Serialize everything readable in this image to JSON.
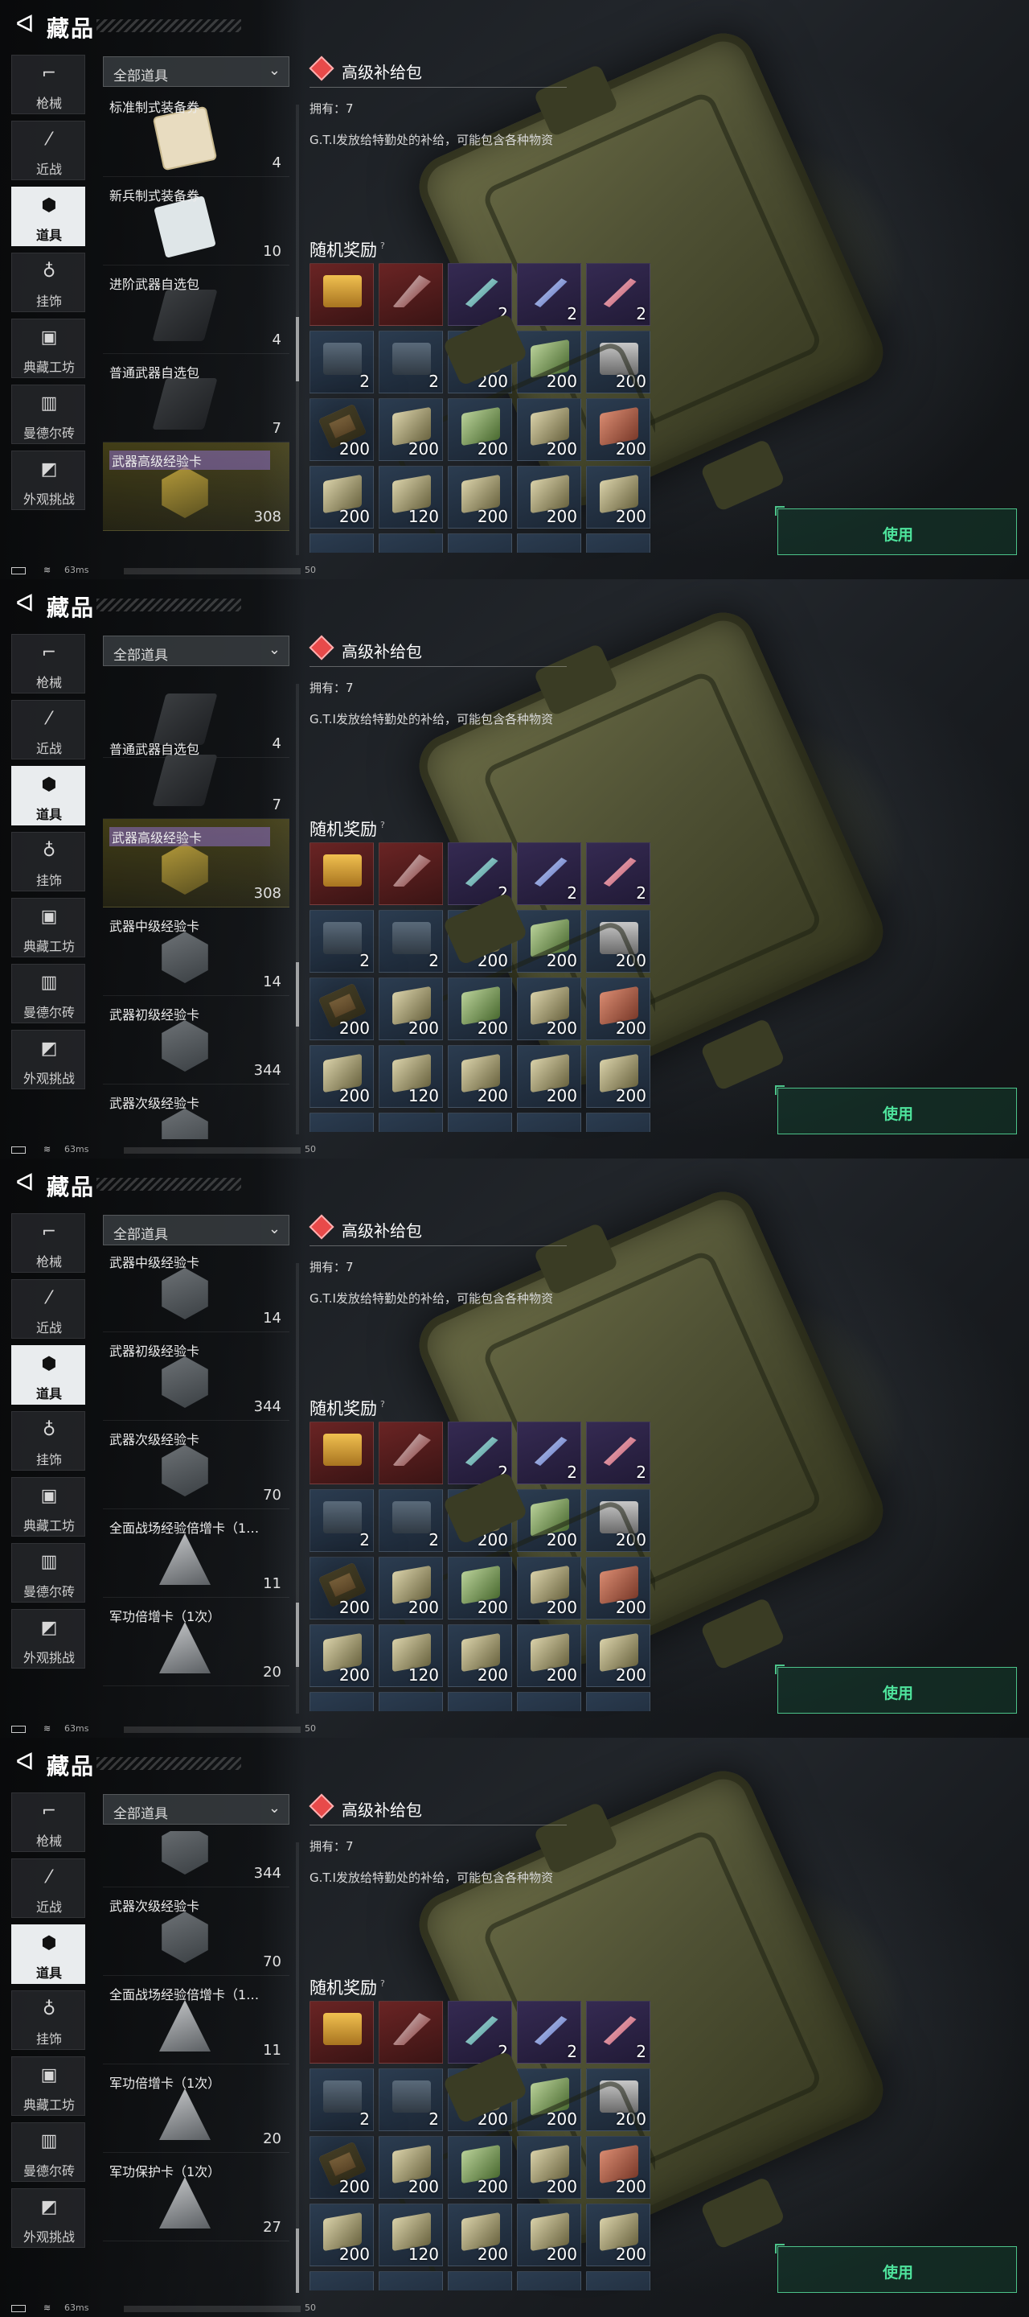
{
  "header": {
    "back_icon": "back-arrow-icon",
    "title": "藏品"
  },
  "categories": [
    {
      "label": "枪械",
      "icon": "gun-icon"
    },
    {
      "label": "近战",
      "icon": "knife-icon"
    },
    {
      "label": "道具",
      "icon": "grenades-icon",
      "active": true
    },
    {
      "label": "挂饰",
      "icon": "charm-icon"
    },
    {
      "label": "典藏工坊",
      "icon": "workshop-icon"
    },
    {
      "label": "曼德尔砖",
      "icon": "brick-icon"
    },
    {
      "label": "外观挑战",
      "icon": "challenge-icon"
    }
  ],
  "filter": {
    "value": "全部道具"
  },
  "detail": {
    "name": "高级补给包",
    "owned": "拥有：7",
    "desc": "G.T.I发放给特勤处的补给，可能包含各种物资",
    "rewards_title": "随机奖励",
    "rewards_tip": "?"
  },
  "use_label": "使用",
  "status": {
    "ping": "63ms",
    "fps": "50"
  },
  "rewards": [
    {
      "cls": "red",
      "g": "gold",
      "n": ""
    },
    {
      "cls": "red",
      "g": "knife",
      "n": ""
    },
    {
      "cls": "pur",
      "g": "syr",
      "n": "2"
    },
    {
      "cls": "pur",
      "g": "syrb",
      "n": "2"
    },
    {
      "cls": "pur",
      "g": "syrr",
      "n": "2"
    },
    {
      "cls": "",
      "g": "pack",
      "n": "2"
    },
    {
      "cls": "",
      "g": "pack",
      "n": "2"
    },
    {
      "cls": "",
      "g": "ammo",
      "n": "200"
    },
    {
      "cls": "",
      "g": "ammog",
      "n": "200"
    },
    {
      "cls": "",
      "g": "tin",
      "n": "200"
    },
    {
      "cls": "",
      "g": "crate",
      "n": "200"
    },
    {
      "cls": "",
      "g": "ammo",
      "n": "200"
    },
    {
      "cls": "",
      "g": "ammog",
      "n": "200"
    },
    {
      "cls": "",
      "g": "ammo",
      "n": "200"
    },
    {
      "cls": "",
      "g": "ammor",
      "n": "200"
    },
    {
      "cls": "",
      "g": "ammo",
      "n": "200"
    },
    {
      "cls": "",
      "g": "ammo",
      "n": "120"
    },
    {
      "cls": "",
      "g": "ammo",
      "n": "200"
    },
    {
      "cls": "",
      "g": "ammo",
      "n": "200"
    },
    {
      "cls": "",
      "g": "ammo",
      "n": "200"
    }
  ],
  "panels": [
    {
      "scroll_progress": 0.55,
      "items": [
        {
          "name": "标准制式装备券",
          "count": "4",
          "pic": "card"
        },
        {
          "name": "新兵制式装备券",
          "count": "10",
          "pic": "paper"
        },
        {
          "name": "进阶武器自选包",
          "count": "4",
          "pic": "box"
        },
        {
          "name": "普通武器自选包",
          "count": "7",
          "pic": "box"
        },
        {
          "name": "武器高级经验卡",
          "count": "308",
          "pic": "hexg",
          "sel": true,
          "hl": true
        }
      ]
    },
    {
      "scroll_progress": 0.72,
      "items": [
        {
          "name": "",
          "count": "4",
          "pic": "box"
        },
        {
          "name": "普通武器自选包",
          "count": "7",
          "pic": "box"
        },
        {
          "name": "武器高级经验卡",
          "count": "308",
          "pic": "hexg",
          "sel": true,
          "hl": true
        },
        {
          "name": "武器中级经验卡",
          "count": "14",
          "pic": "hex"
        },
        {
          "name": "武器初级经验卡",
          "count": "344",
          "pic": "hex"
        },
        {
          "name": "武器次级经验卡",
          "count": "",
          "pic": "hex"
        }
      ]
    },
    {
      "scroll_progress": 0.88,
      "items": [
        {
          "name": "武器中级经验卡",
          "count": "14",
          "pic": "hex"
        },
        {
          "name": "武器初级经验卡",
          "count": "344",
          "pic": "hex"
        },
        {
          "name": "武器次级经验卡",
          "count": "70",
          "pic": "hex"
        },
        {
          "name": "全面战场经验倍增卡（1…",
          "count": "11",
          "pic": "tri"
        },
        {
          "name": "军功倍增卡（1次）",
          "count": "20",
          "pic": "tri"
        }
      ]
    },
    {
      "scroll_progress": 1.0,
      "items": [
        {
          "name": "",
          "count": "344",
          "pic": "hex"
        },
        {
          "name": "武器次级经验卡",
          "count": "70",
          "pic": "hex"
        },
        {
          "name": "全面战场经验倍增卡（1…",
          "count": "11",
          "pic": "tri"
        },
        {
          "name": "军功倍增卡（1次）",
          "count": "20",
          "pic": "tri"
        },
        {
          "name": "军功保护卡（1次）",
          "count": "27",
          "pic": "tri"
        }
      ]
    }
  ]
}
